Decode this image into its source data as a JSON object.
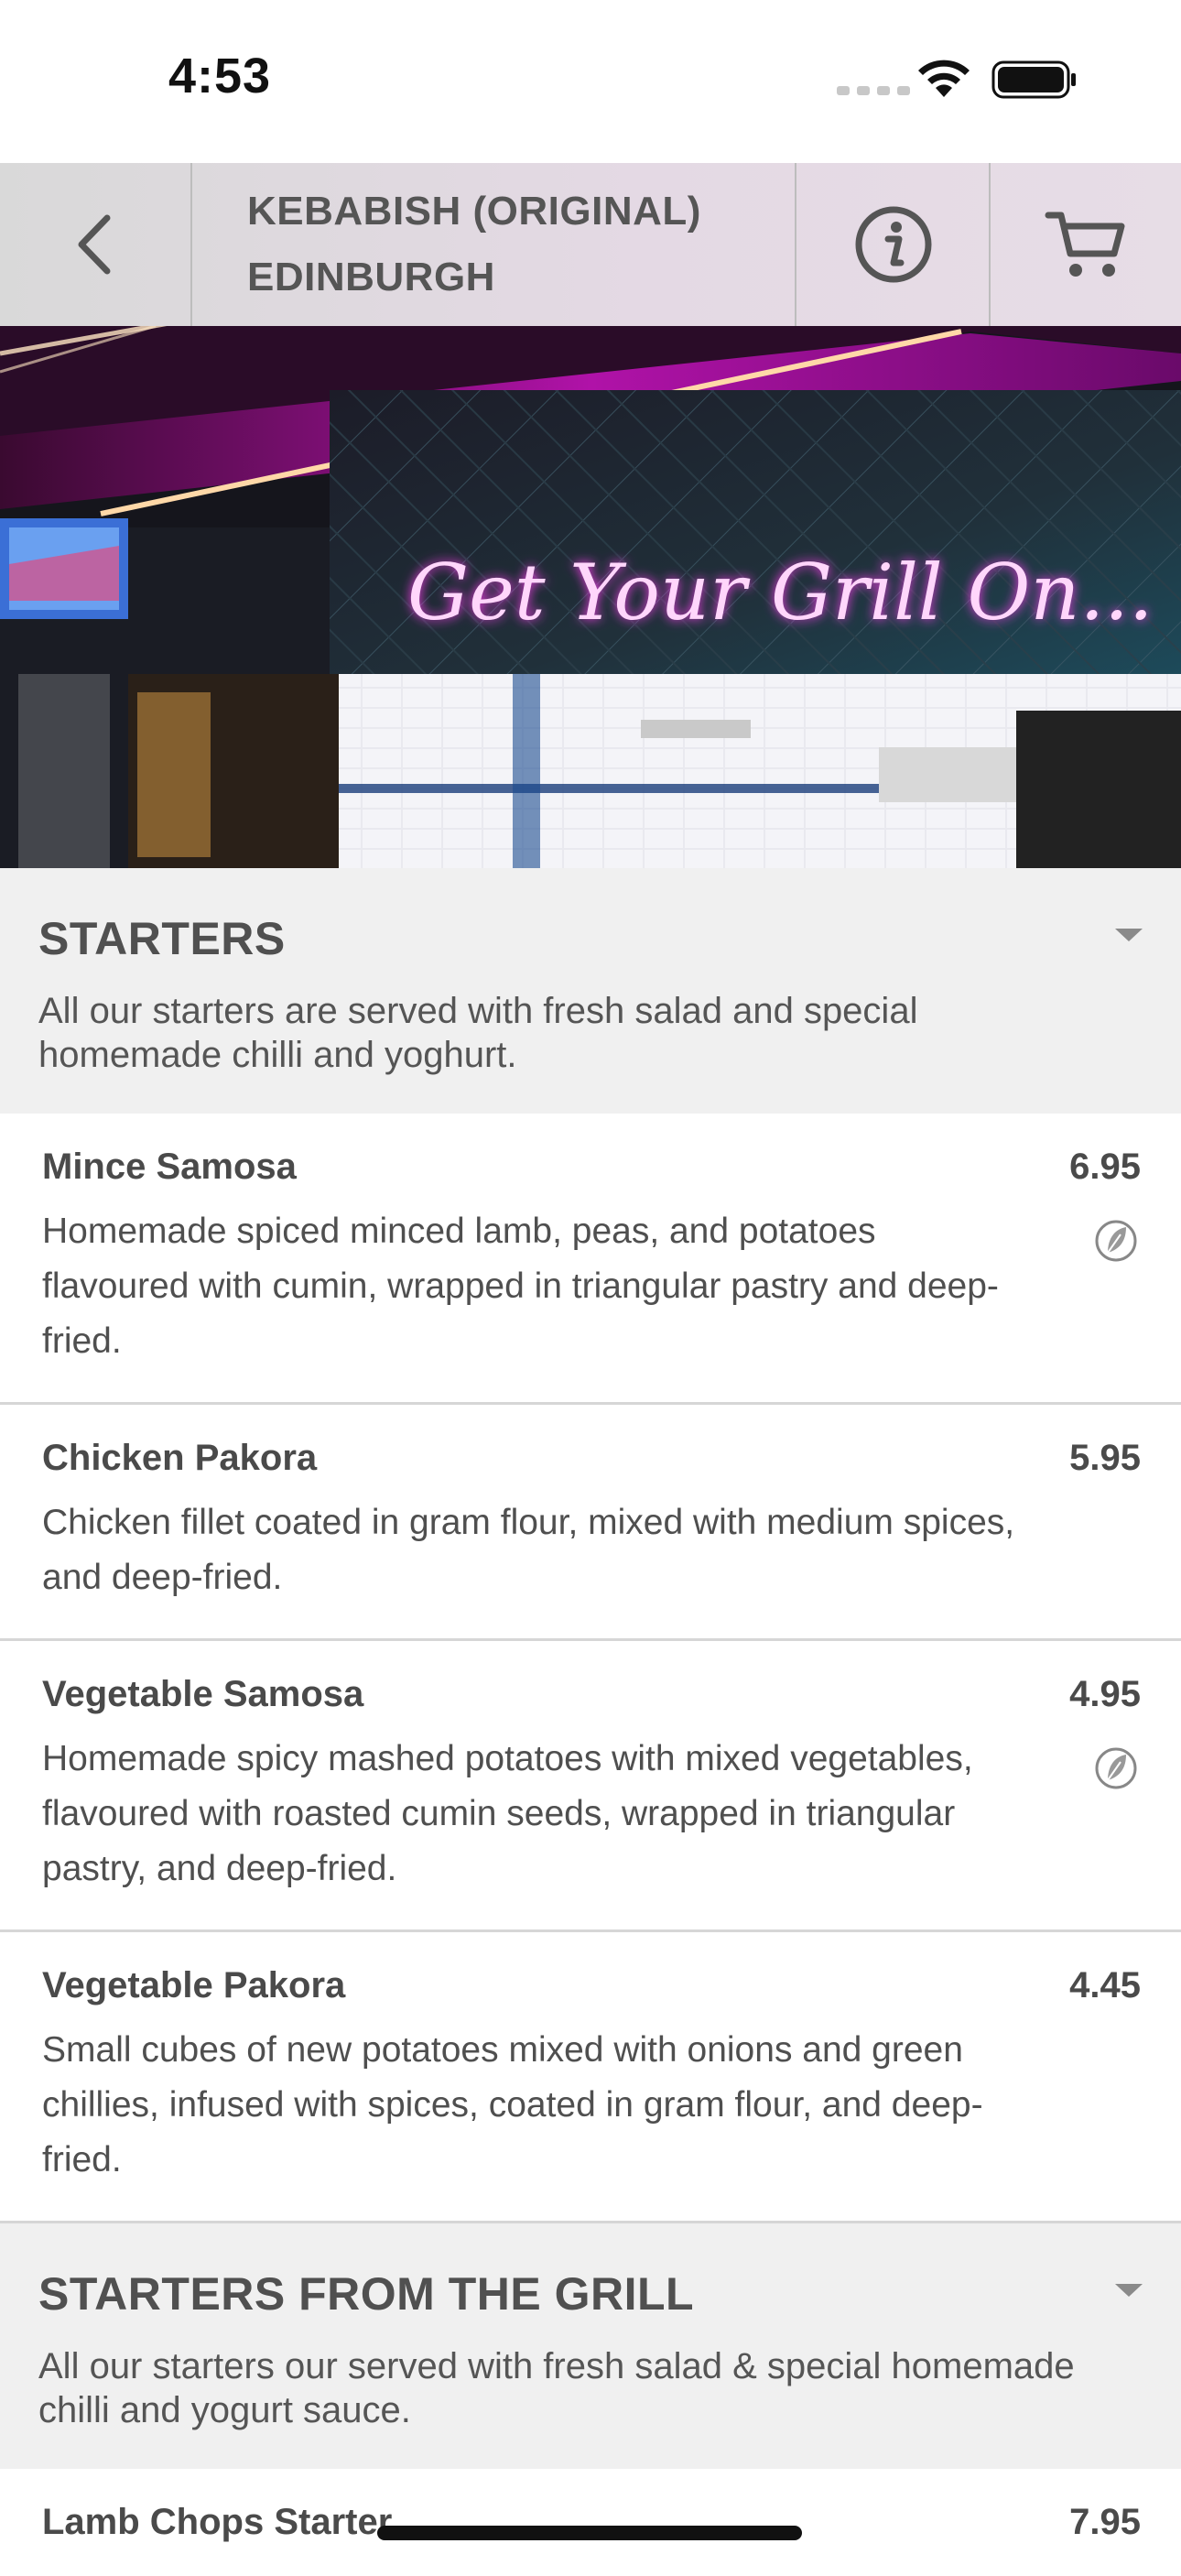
{
  "status_bar": {
    "time": "4:53"
  },
  "header": {
    "title_line1": "KEBABISH (ORIGINAL)",
    "title_line2": "EDINBURGH"
  },
  "hero": {
    "sign_text": "Get Your Grill On..."
  },
  "sections": [
    {
      "title": "STARTERS",
      "description": "All our starters are served with fresh salad and special homemade chilli and yoghurt.",
      "items": [
        {
          "name": "Mince Samosa",
          "price": "6.95",
          "description": "Homemade spiced minced lamb, peas, and potatoes flavoured with cumin, wrapped in triangular pastry and deep-fried."
        },
        {
          "name": "Chicken Pakora",
          "price": "5.95",
          "description": "Chicken fillet coated in gram flour, mixed with medium spices, and deep-fried."
        },
        {
          "name": "Vegetable Samosa",
          "price": "4.95",
          "description": "Homemade spicy mashed potatoes with mixed vegetables, flavoured with roasted cumin seeds, wrapped in triangular pastry, and deep-fried."
        },
        {
          "name": "Vegetable Pakora",
          "price": "4.45",
          "description": "Small cubes of new potatoes mixed with onions and green chillies, infused with spices, coated in gram flour, and deep-fried."
        }
      ]
    },
    {
      "title": "STARTERS FROM THE GRILL",
      "description": "All our starters our served with fresh salad & special homemade chilli and yogurt sauce.",
      "items": [
        {
          "name": "Lamb Chops Starter",
          "price": "7.95"
        }
      ]
    }
  ],
  "icons": {
    "back": "chevron-left-icon",
    "info": "info-icon",
    "cart": "cart-icon",
    "diet": "leaf-icon",
    "collapse": "caret-down-icon"
  },
  "colors": {
    "neon": "#ff3cf0",
    "section_bg": "#f0f0f0",
    "header_bg": "#e4d9e4"
  }
}
